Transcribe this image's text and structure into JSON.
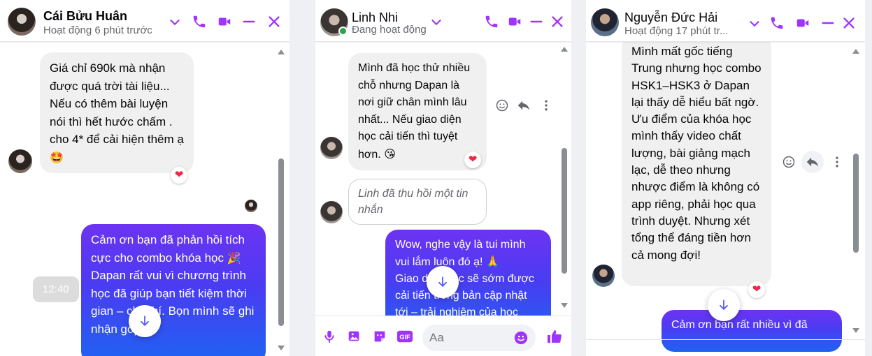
{
  "colors": {
    "accent": "#a033ff",
    "outgoing_start": "#6d33f2",
    "outgoing_end": "#1e63f2",
    "heart": "#f0284a"
  },
  "chats": [
    {
      "contact_name": "Cái Bửu Huân",
      "status": "Hoạt động 6 phút trước",
      "messages": [
        {
          "from": "contact",
          "text": "Giá chỉ 690k mà nhận được quá trời tài liệu... Nếu có thêm bài luyện nói thì hết hước chấm . cho 4* để cải hiện thêm ạ",
          "emoji": "🤩",
          "reaction": "❤"
        },
        {
          "from": "me",
          "time": "12:40",
          "text_1": "Cảm ơn bạn đã phản hồi tích cực cho combo khóa học",
          "emoji": "🎉",
          "text_2": "Dapan rất vui vì chương trình học đã giúp bạn tiết kiệm thời gian – chi phí. Bọn mình sẽ ghi nhận góp ý"
        }
      ]
    },
    {
      "contact_name": "Linh Nhi",
      "status": "Đang hoạt động",
      "messages": [
        {
          "from": "contact",
          "text": "Mình đã học thử nhiều chỗ nhưng Dapan là nơi giữ chân mình lâu nhất... Nếu giao diện học cải tiến thì tuyệt hơn.",
          "emoji": "😘",
          "reaction": "❤"
        },
        {
          "from": "contact",
          "recalled": true,
          "text": "Linh đã thu hồi một tin nhắn"
        },
        {
          "from": "me",
          "text_1": "Wow, nghe vậy là tui mình vui lắm luôn đó ạ!",
          "emoji": "🙏",
          "text_2": "Giao diện học sẽ sớm được cải tiến trong bản cập nhật tới – trải nghiệm của học"
        }
      ],
      "composer": {
        "placeholder": "Aa"
      }
    },
    {
      "contact_name": "Nguyễn Đức Hải",
      "status": "Hoạt động 17 phút tr...",
      "messages": [
        {
          "from": "contact",
          "text": "Mình mất gốc tiếng Trung nhưng học combo HSK1–HSK3 ở Dapan lại thấy dễ hiểu bất ngờ. Ưu điểm của khóa học mình thấy video chất lượng, bài giảng mạch lạc, dễ theo nhưng nhược điểm là không có app riêng, phải học qua trình duyệt. Nhưng xét tổng thể đáng tiền hơn cả mong đợi!",
          "reaction": "❤"
        },
        {
          "from": "me",
          "text": "Cảm ơn bạn rất nhiều vì đã"
        }
      ]
    }
  ]
}
